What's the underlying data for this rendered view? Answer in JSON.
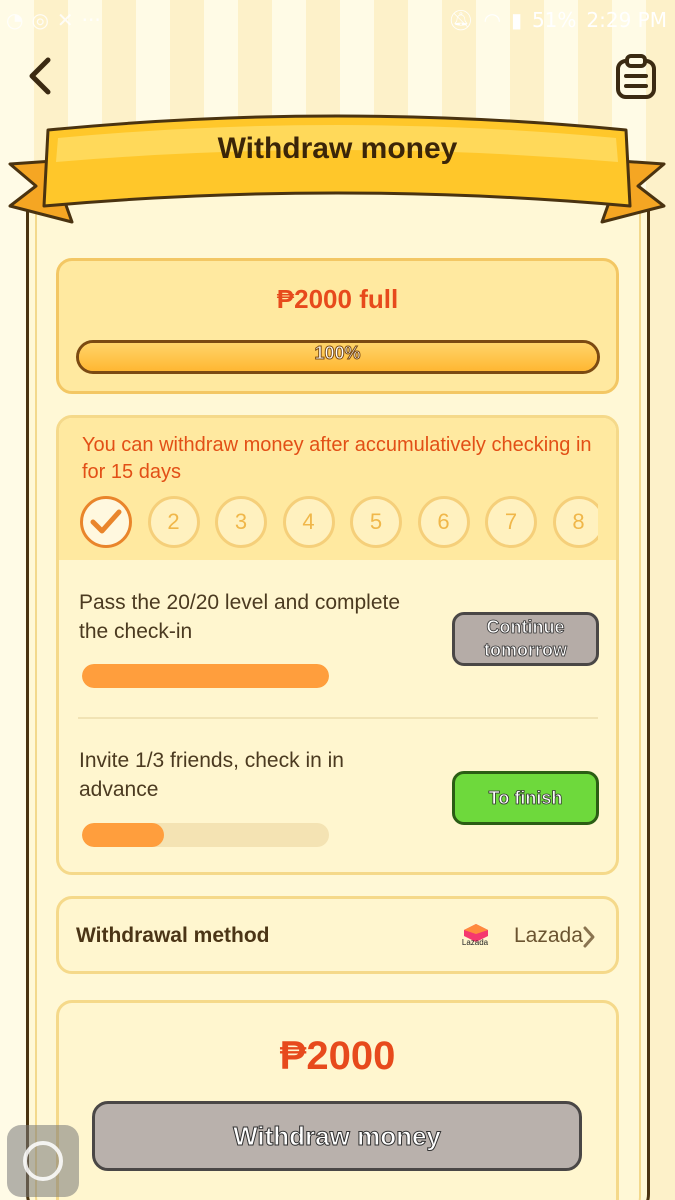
{
  "status_bar": {
    "battery": "51%",
    "time": "2:29 PM"
  },
  "header": {
    "title": "Withdraw money"
  },
  "goal": {
    "amount_text": "₱2000 full",
    "progress": 100,
    "progress_label": "100%"
  },
  "checkin": {
    "message": "You can withdraw money after accumulatively checking in for 15 days",
    "days": [
      "1",
      "2",
      "3",
      "4",
      "5",
      "6",
      "7",
      "8"
    ],
    "completed_days": 1
  },
  "tasks": [
    {
      "text": "Pass the 20/20 level and complete the check-in",
      "progress": 1.0,
      "button_label": "Continue tomorrow",
      "button_state": "disabled"
    },
    {
      "text": "Invite 1/3 friends, check in in advance",
      "progress": 0.333,
      "button_label": "To finish",
      "button_state": "active"
    }
  ],
  "method": {
    "label": "Withdrawal method",
    "provider": "Lazada",
    "provider_logo_text": "Lazada"
  },
  "withdraw": {
    "amount": "₱2000",
    "button_label": "Withdraw money"
  },
  "colors": {
    "accent": "#e74a1c",
    "ribbon": "#ffc72a",
    "green": "#6ed93c",
    "gray": "#b5aca7"
  }
}
